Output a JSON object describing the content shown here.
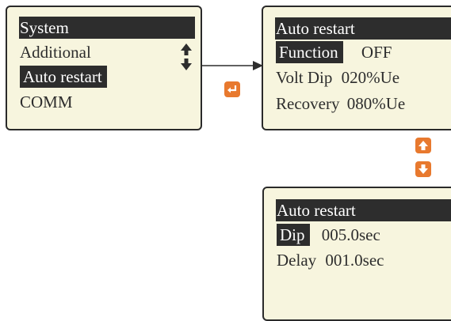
{
  "menu_screen": {
    "items": [
      "System",
      "Additional",
      "Auto restart",
      "COMM"
    ],
    "highlighted": [
      "System",
      "Auto restart"
    ]
  },
  "settings_screen": {
    "title": "Auto restart",
    "function_label": "Function",
    "function_value": "OFF",
    "volt_dip_label": "Volt Dip",
    "volt_dip_value": "020%Ue",
    "recovery_label": "Recovery",
    "recovery_value": "080%Ue"
  },
  "timing_screen": {
    "title": "Auto restart",
    "dip_label": "Dip",
    "dip_value": "005.0sec",
    "delay_label": "Delay",
    "delay_value": "001.0sec"
  },
  "colors": {
    "screen_bg": "#f7f5de",
    "highlight": "#2d2d2d",
    "button": "#e8792e"
  },
  "icons": [
    "scroll-up-down-icon",
    "enter-key-icon",
    "up-key-icon",
    "down-key-icon",
    "arrow-right-icon"
  ]
}
